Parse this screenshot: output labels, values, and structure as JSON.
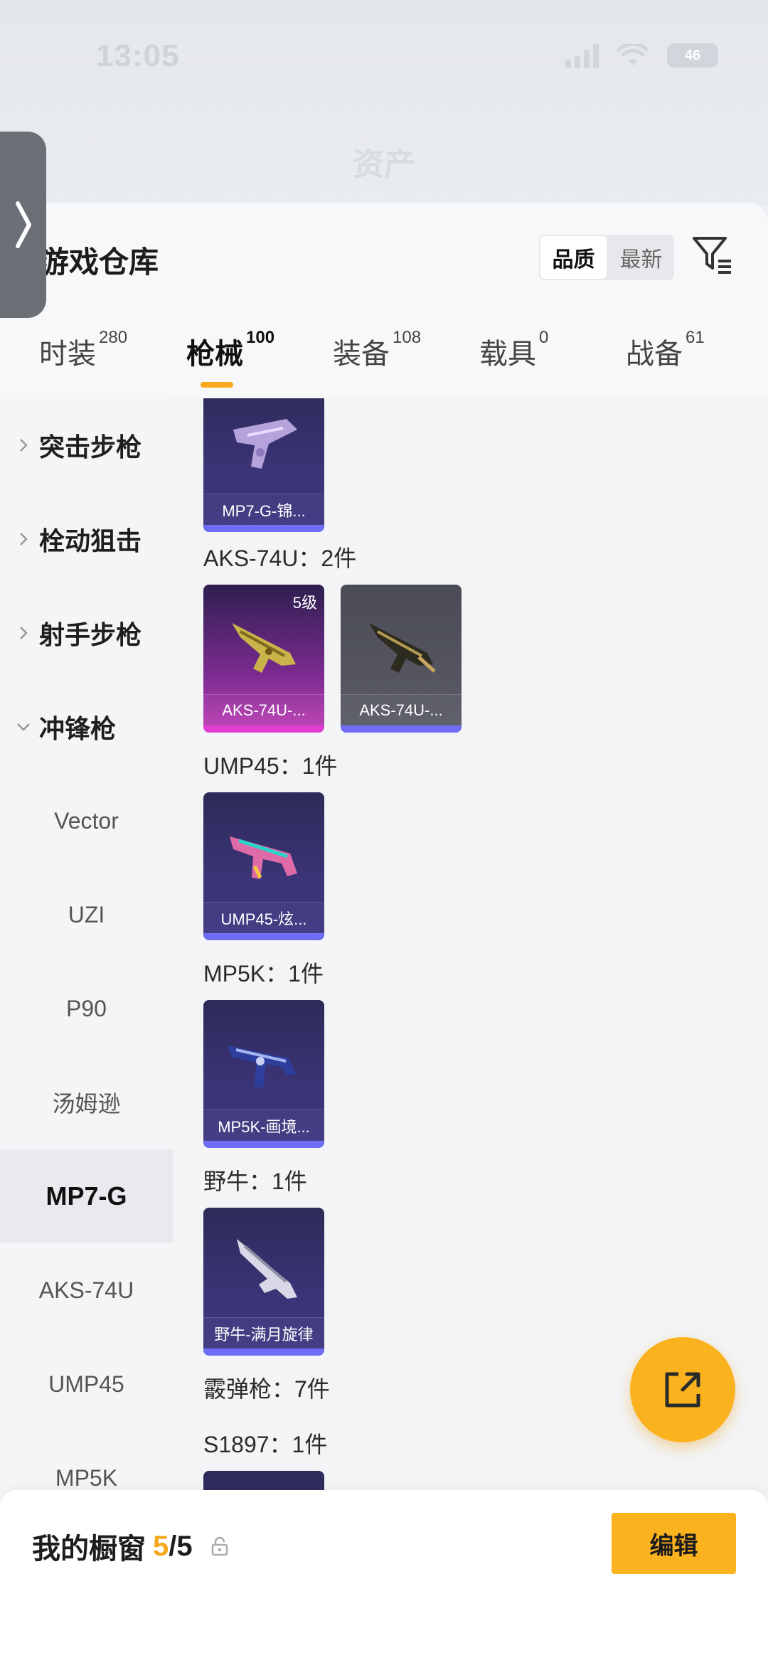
{
  "status_bar": {
    "time": "13:05",
    "battery": "46"
  },
  "nav": {
    "title": "资产"
  },
  "panel": {
    "title": "游戏仓库"
  },
  "sort": {
    "quality": "品质",
    "newest": "最新"
  },
  "tabs": [
    {
      "label": "时装",
      "count": "280"
    },
    {
      "label": "枪械",
      "count": "100"
    },
    {
      "label": "装备",
      "count": "108"
    },
    {
      "label": "载具",
      "count": "0"
    },
    {
      "label": "战备",
      "count": "61"
    }
  ],
  "sidebar": {
    "categories": [
      "突击步枪",
      "栓动狙击",
      "射手步枪",
      "冲锋枪"
    ],
    "subs": [
      "Vector",
      "UZI",
      "P90",
      "汤姆逊",
      "MP7-G",
      "AKS-74U",
      "UMP45",
      "MP5K"
    ]
  },
  "groups": [
    {
      "label": "AKS-74U：2件"
    },
    {
      "label": "UMP45：1件"
    },
    {
      "label": "MP5K：1件"
    },
    {
      "label": "野牛：1件"
    },
    {
      "label": "霰弹枪：7件"
    },
    {
      "label": "S1897：1件"
    }
  ],
  "cards": [
    {
      "name": "MP7-G-锦..."
    },
    {
      "name": "AKS-74U-...",
      "level": "5级"
    },
    {
      "name": "AKS-74U-..."
    },
    {
      "name": "UMP45-炫..."
    },
    {
      "name": "MP5K-画境..."
    },
    {
      "name": "野牛-满月旋律"
    }
  ],
  "showcase": {
    "label": "我的橱窗",
    "current": "5",
    "total": "/5",
    "edit": "编辑"
  },
  "colors": {
    "accent": "#fbb21f",
    "card_blue": "#6f6cf5",
    "card_pink": "#e03ed0"
  }
}
